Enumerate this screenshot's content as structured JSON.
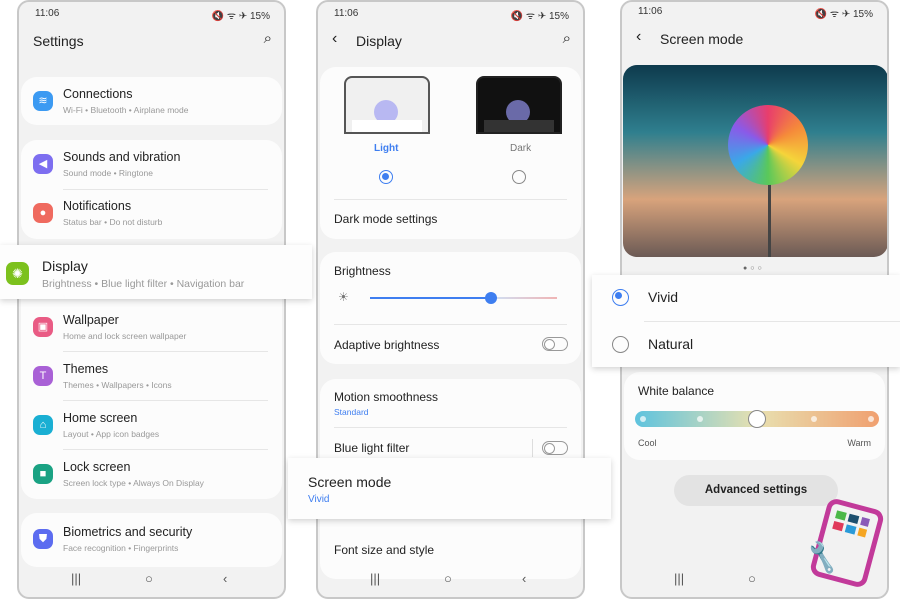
{
  "status": {
    "time": "11:06",
    "icons": "🔇 ᯤ ✈ 15%",
    "battery": "15%"
  },
  "settings": {
    "title": "Settings",
    "items": [
      {
        "label": "Connections",
        "sub": "Wi-Fi  •  Bluetooth  •  Airplane mode",
        "icon": "wifi-icon",
        "color": "#3c9af2"
      },
      {
        "label": "Sounds and vibration",
        "sub": "Sound mode  •  Ringtone",
        "icon": "speaker-icon",
        "color": "#7d6ef0"
      },
      {
        "label": "Notifications",
        "sub": "Status bar  •  Do not disturb",
        "icon": "notification-icon",
        "color": "#ef6a5f"
      },
      {
        "label": "Display",
        "sub": "Brightness  •  Blue light filter  •  Navigation bar",
        "icon": "sun-icon",
        "color": "#7cc11d"
      },
      {
        "label": "Wallpaper",
        "sub": "Home and lock screen wallpaper",
        "icon": "image-icon",
        "color": "#e95b84"
      },
      {
        "label": "Themes",
        "sub": "Themes  •  Wallpapers  •  Icons",
        "icon": "brush-icon",
        "color": "#a961d6"
      },
      {
        "label": "Home screen",
        "sub": "Layout  •  App icon badges",
        "icon": "home-icon",
        "color": "#1aafd3"
      },
      {
        "label": "Lock screen",
        "sub": "Screen lock type  •  Always On Display",
        "icon": "lock-icon",
        "color": "#1aa283"
      },
      {
        "label": "Biometrics and security",
        "sub": "Face recognition  •  Fingerprints",
        "icon": "shield-icon",
        "color": "#5c6cf0"
      }
    ]
  },
  "display": {
    "title": "Display",
    "light": "Light",
    "dark": "Dark",
    "selected_mode": "Light",
    "dark_mode_settings": "Dark mode settings",
    "brightness": "Brightness",
    "brightness_level": 0.65,
    "adaptive_brightness": "Adaptive brightness",
    "adaptive_on": false,
    "motion_smoothness": "Motion smoothness",
    "motion_value": "Standard",
    "blue_light_filter": "Blue light filter",
    "blue_light_on": false,
    "screen_mode": "Screen mode",
    "screen_mode_value": "Vivid",
    "font_size": "Font size and style"
  },
  "screen_mode": {
    "title": "Screen mode",
    "options": [
      "Vivid",
      "Natural"
    ],
    "selected": "Vivid",
    "white_balance": "White balance",
    "white_balance_step": 2,
    "white_balance_steps": 5,
    "cool": "Cool",
    "warm": "Warm",
    "advanced": "Advanced settings",
    "accent": "#3e7ef0"
  }
}
